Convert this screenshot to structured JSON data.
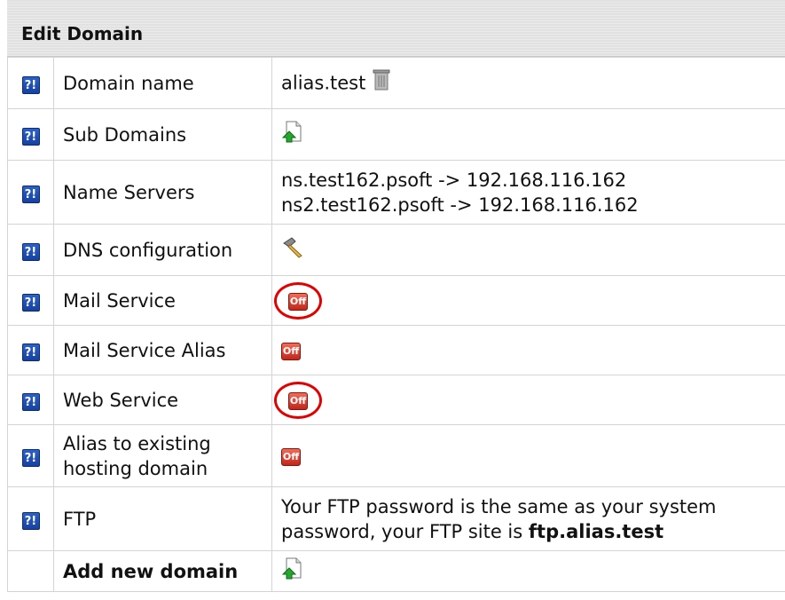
{
  "panel": {
    "title": "Edit Domain"
  },
  "help_glyph": "?!",
  "rows": [
    {
      "label": "Domain name",
      "value": "alias.test",
      "icon": "trash-icon"
    },
    {
      "label": "Sub Domains",
      "icon": "add-document-icon"
    },
    {
      "label": "Name Servers",
      "lines": [
        "ns.test162.psoft -> 192.168.116.162",
        "ns2.test162.psoft -> 192.168.116.162"
      ]
    },
    {
      "label": "DNS configuration",
      "icon": "hammer-tool-icon"
    },
    {
      "label": "Mail Service",
      "toggle": "Off",
      "circled": true
    },
    {
      "label": "Mail Service Alias",
      "toggle": "Off"
    },
    {
      "label": "Web Service",
      "toggle": "Off",
      "circled": true
    },
    {
      "label_lines": [
        "Alias to existing",
        "hosting domain"
      ],
      "toggle": "Off"
    },
    {
      "label": "FTP",
      "text_line1": "Your FTP password is the same as your system",
      "text_line2_prefix": "password, your FTP site is ",
      "text_line2_bold": "ftp.alias.test"
    },
    {
      "label": "Add new domain",
      "icon": "add-document-icon"
    }
  ],
  "colors": {
    "help_blue": "#1f4fb5",
    "off_red": "#d63a2b",
    "annotation_red": "#e30000"
  }
}
